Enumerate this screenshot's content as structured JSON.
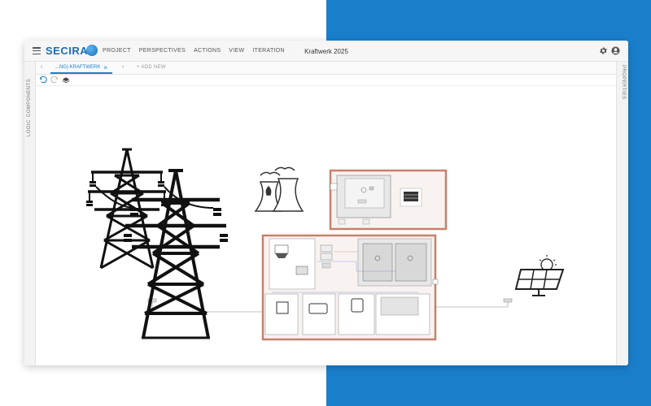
{
  "app": {
    "logo": "SECIRA",
    "menu": [
      "PROJECT",
      "PERSPECTIVES",
      "ACTIONS",
      "VIEW",
      "ITERATION"
    ],
    "window_title": "Kraftwerk 2025"
  },
  "tabs": {
    "active_label": "...NG) KRAFTWERK",
    "add_new_label": "+ ADD NEW"
  },
  "side_panels": {
    "left": [
      "COMPONENTS",
      "LOGIC"
    ],
    "right": [
      "PROPERTIES"
    ]
  },
  "icons": {
    "menu": "hamburger-icon",
    "settings": "gear-icon",
    "account": "user-icon",
    "undo": "undo-icon",
    "redo": "redo-icon",
    "layers": "layers-icon"
  },
  "colors": {
    "brand": "#1a6fb5",
    "background_accent": "#1a7fcb",
    "group_border": "#c8806a",
    "diagram_line": "#555555"
  }
}
